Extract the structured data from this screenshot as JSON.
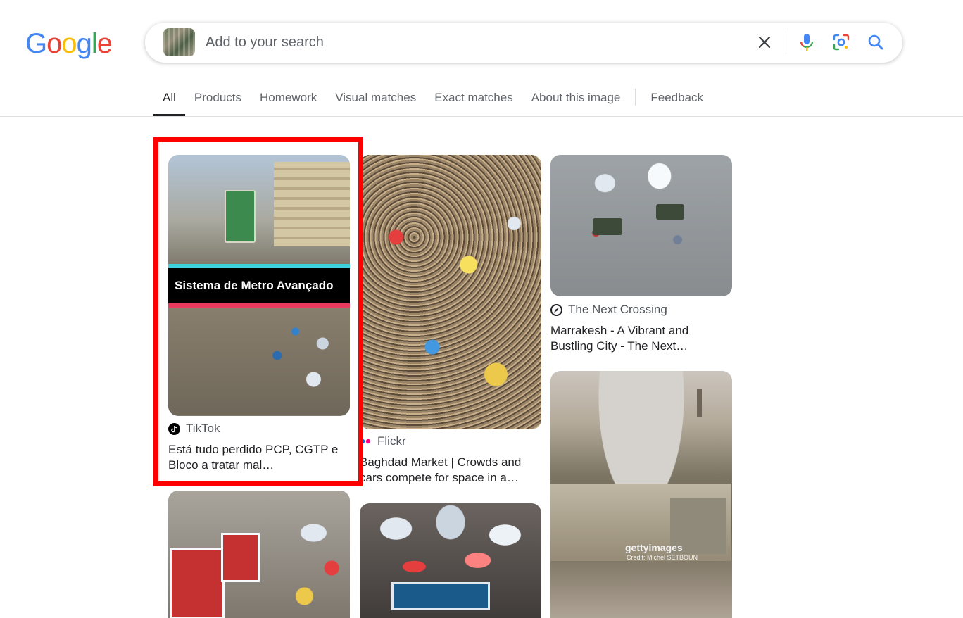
{
  "logo": {
    "letters": [
      "G",
      "o",
      "o",
      "g",
      "l",
      "e"
    ],
    "colors": [
      "#4285F4",
      "#EA4335",
      "#FBBC05",
      "#4285F4",
      "#34A853",
      "#EA4335"
    ]
  },
  "search": {
    "placeholder": "Add to your search",
    "value": ""
  },
  "icons": {
    "clear": "close-icon",
    "voice": "microphone-icon",
    "lens": "lens-camera-icon",
    "search": "search-icon"
  },
  "tabs": [
    {
      "label": "All",
      "active": true
    },
    {
      "label": "Products"
    },
    {
      "label": "Homework"
    },
    {
      "label": "Visual matches"
    },
    {
      "label": "Exact matches"
    },
    {
      "label": "About this image"
    },
    {
      "label": "Feedback"
    }
  ],
  "results": [
    {
      "source": "TikTok",
      "title_line1": "Está tudo perdido PCP, CGTP e",
      "title_line2": "Bloco a tratar mal…",
      "overlay_text": "Sistema de Metro Avançado",
      "highlighted": true
    },
    {
      "source": "Flickr",
      "title_line1": "Baghdad Market | Crowds and",
      "title_line2": "cars compete for space in a…"
    },
    {
      "source": "The Next Crossing",
      "title_line1": "Marrakesh - A Vibrant and",
      "title_line2": "Bustling City - The Next…"
    },
    {
      "watermark": "gettyimages",
      "credit": "Credit: Michel SETBOUN"
    },
    {},
    {}
  ],
  "colors": {
    "highlight": "#ff0000",
    "accent_blue": "#4285F4"
  }
}
